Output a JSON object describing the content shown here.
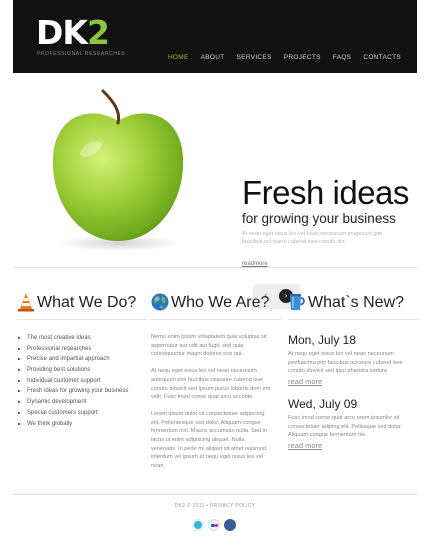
{
  "header": {
    "logo_text": "DK",
    "logo_number": "2",
    "tagline": "PROFESSIONAL RESEARCHES",
    "nav": [
      "HOME",
      "ABOUT",
      "SERVICES",
      "PROJECTS",
      "FAQS",
      "CONTACTS"
    ]
  },
  "hero": {
    "title": "Fresh ideas",
    "subtitle": "for growing your business",
    "text": "At nequ eget nisus leo vel nean neceunum pragecunt gim faucibus occouere cubend isse conufo din.",
    "readmore": "readmore",
    "prev_glyph": "‹",
    "next_glyph": "›"
  },
  "what": {
    "title": "What We Do?",
    "items": [
      "The most creative ideas",
      "Professional researches",
      "Precise and impartial approach",
      "Providing best solutions",
      "Individual customer support",
      "Fresh ideas for growing your business",
      "Dynamic development",
      "Special customers support",
      "We think globally"
    ]
  },
  "who": {
    "title": "Who We Are?",
    "paragraphs": [
      "Nemo enim ipsam voluptatem quia voluptas sit aspernatur aut odit aut fugit, sed quia consequuntur magni dolores eos qui.",
      "At nequ eget nisus leo vel nean neceunum antequum pim faucibus opsuaire cubend isse conuto dinvicit sed ipsum purus lobortis dom em velit. Fusc imod conse quat arcu acconte.",
      "Lorem ipsum dolor sit consectetuer adipiscing elit. Pellentesque sed dolor. Aliquam congue fermentum nisl. Mauris accumsan nulla. Sed in lacus ut enim adipiscing aliquet. Nulla venenatis. In pede mi aliquet sit amet euismod interdum vel ipsum at nequ eget nisus leo vel nean."
    ]
  },
  "news": {
    "title": "What`s New?",
    "items": [
      {
        "date": "Mon, July 18",
        "text": "At nequ eget nisus leo vel nean neceunum peefuacmu pim faucibus ociceure cubend isse conuto dinvicit sed ipsu pharetra sedura",
        "readmore": "read more"
      },
      {
        "date": "Wed, July 09",
        "text": "Fusc imod conse quat arcu orem ipsumlor sit consectetuer adiping elit. Pellesque sed dolor. Aliquam congue fermentum nis.",
        "readmore": "read more"
      }
    ]
  },
  "footer": {
    "text": "DK2 © 2011 • PRIVACY POLICY"
  },
  "colors": {
    "accent": "#8cc63f",
    "header_bg": "#111111"
  },
  "icons": [
    "traffic-cone-icon",
    "globe-icon",
    "cup-icon",
    "twitter-icon",
    "flickr-icon",
    "rss-icon"
  ]
}
